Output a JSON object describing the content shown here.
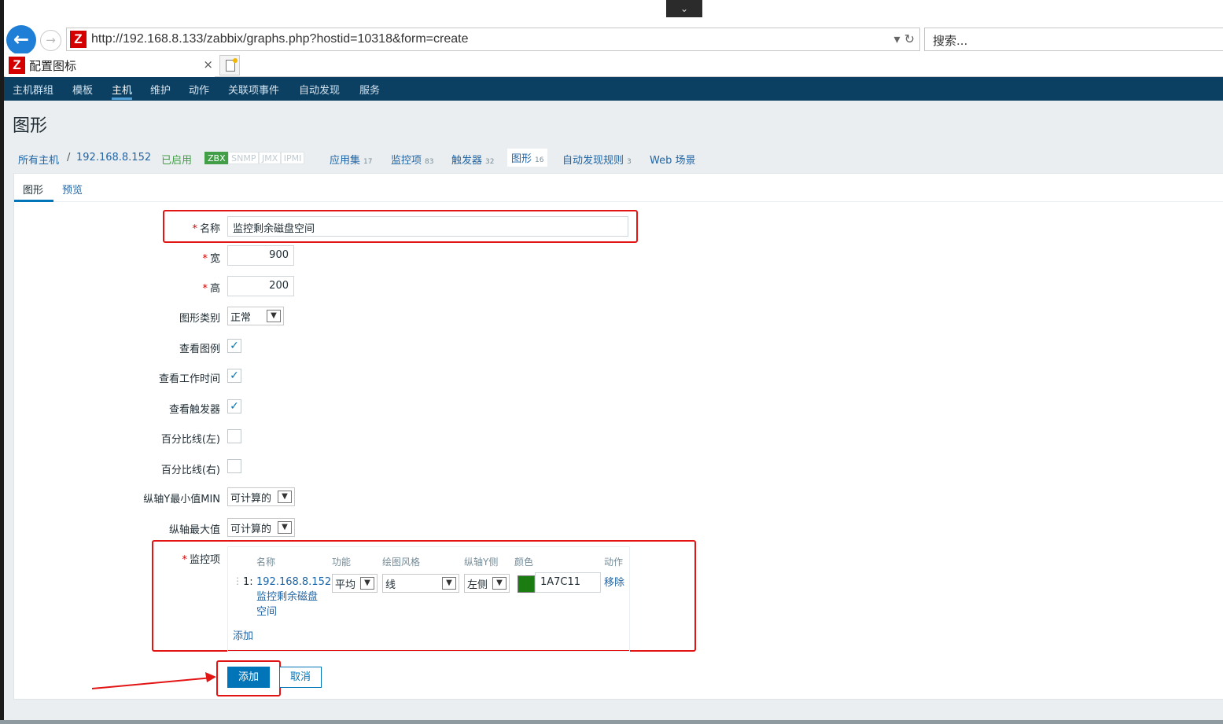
{
  "browser": {
    "url": "http://192.168.8.133/zabbix/graphs.php?hostid=10318&form=create",
    "search_placeholder": "搜索...",
    "tab_title": "配置图标",
    "logo_letter": "Z",
    "tab_close": "×"
  },
  "main_nav": {
    "items": [
      "主机群组",
      "模板",
      "主机",
      "维护",
      "动作",
      "关联项事件",
      "自动发现",
      "服务"
    ],
    "active_index": 2
  },
  "page_title": "图形",
  "breadcrumb": {
    "all_hosts": "所有主机",
    "separator": "/",
    "host": "192.168.8.152",
    "status": "已启用",
    "interfaces": [
      "ZBX",
      "SNMP",
      "JMX",
      "IPMI"
    ],
    "applications": {
      "label": "应用集",
      "count": "17"
    },
    "items": {
      "label": "监控项",
      "count": "83"
    },
    "triggers": {
      "label": "触发器",
      "count": "32"
    },
    "graphs": {
      "label": "图形",
      "count": "16"
    },
    "discovery": {
      "label": "自动发现规则",
      "count": "3"
    },
    "web": {
      "label": "Web 场景"
    }
  },
  "form_tabs": {
    "graph": "图形",
    "preview": "预览"
  },
  "form": {
    "name_label": "名称",
    "name_value": "监控剩余磁盘空间",
    "width_label": "宽",
    "width_value": "900",
    "height_label": "高",
    "height_value": "200",
    "type_label": "图形类别",
    "type_value": "正常",
    "show_legend_label": "查看图例",
    "show_legend": true,
    "show_work_period_label": "查看工作时间",
    "show_work_period": true,
    "show_triggers_label": "查看触发器",
    "show_triggers": true,
    "percentile_left_label": "百分比线(左)",
    "percentile_left": false,
    "percentile_right_label": "百分比线(右)",
    "percentile_right": false,
    "ymin_label": "纵轴Y最小值MIN",
    "ymin_value": "可计算的",
    "ymax_label": "纵轴最大值",
    "ymax_value": "可计算的",
    "items_label": "监控项",
    "items_headers": [
      "名称",
      "功能",
      "绘图风格",
      "纵轴Y侧",
      "颜色",
      "动作"
    ],
    "item_row": {
      "index": "1:",
      "name_line1": "192.168.8.152:",
      "name_line2": "监控剩余磁盘",
      "name_line3": "空间",
      "function": "平均",
      "drawtype": "线",
      "yaxis_side": "左侧",
      "color": "1A7C11",
      "remove": "移除"
    },
    "add_item_link": "添加",
    "submit_label": "添加",
    "cancel_label": "取消"
  },
  "colors": {
    "nav": "#0c4063",
    "link": "#1f65a6",
    "primary": "#0275b8",
    "highlight": "#e31414",
    "swatch": "#1a7c11"
  }
}
